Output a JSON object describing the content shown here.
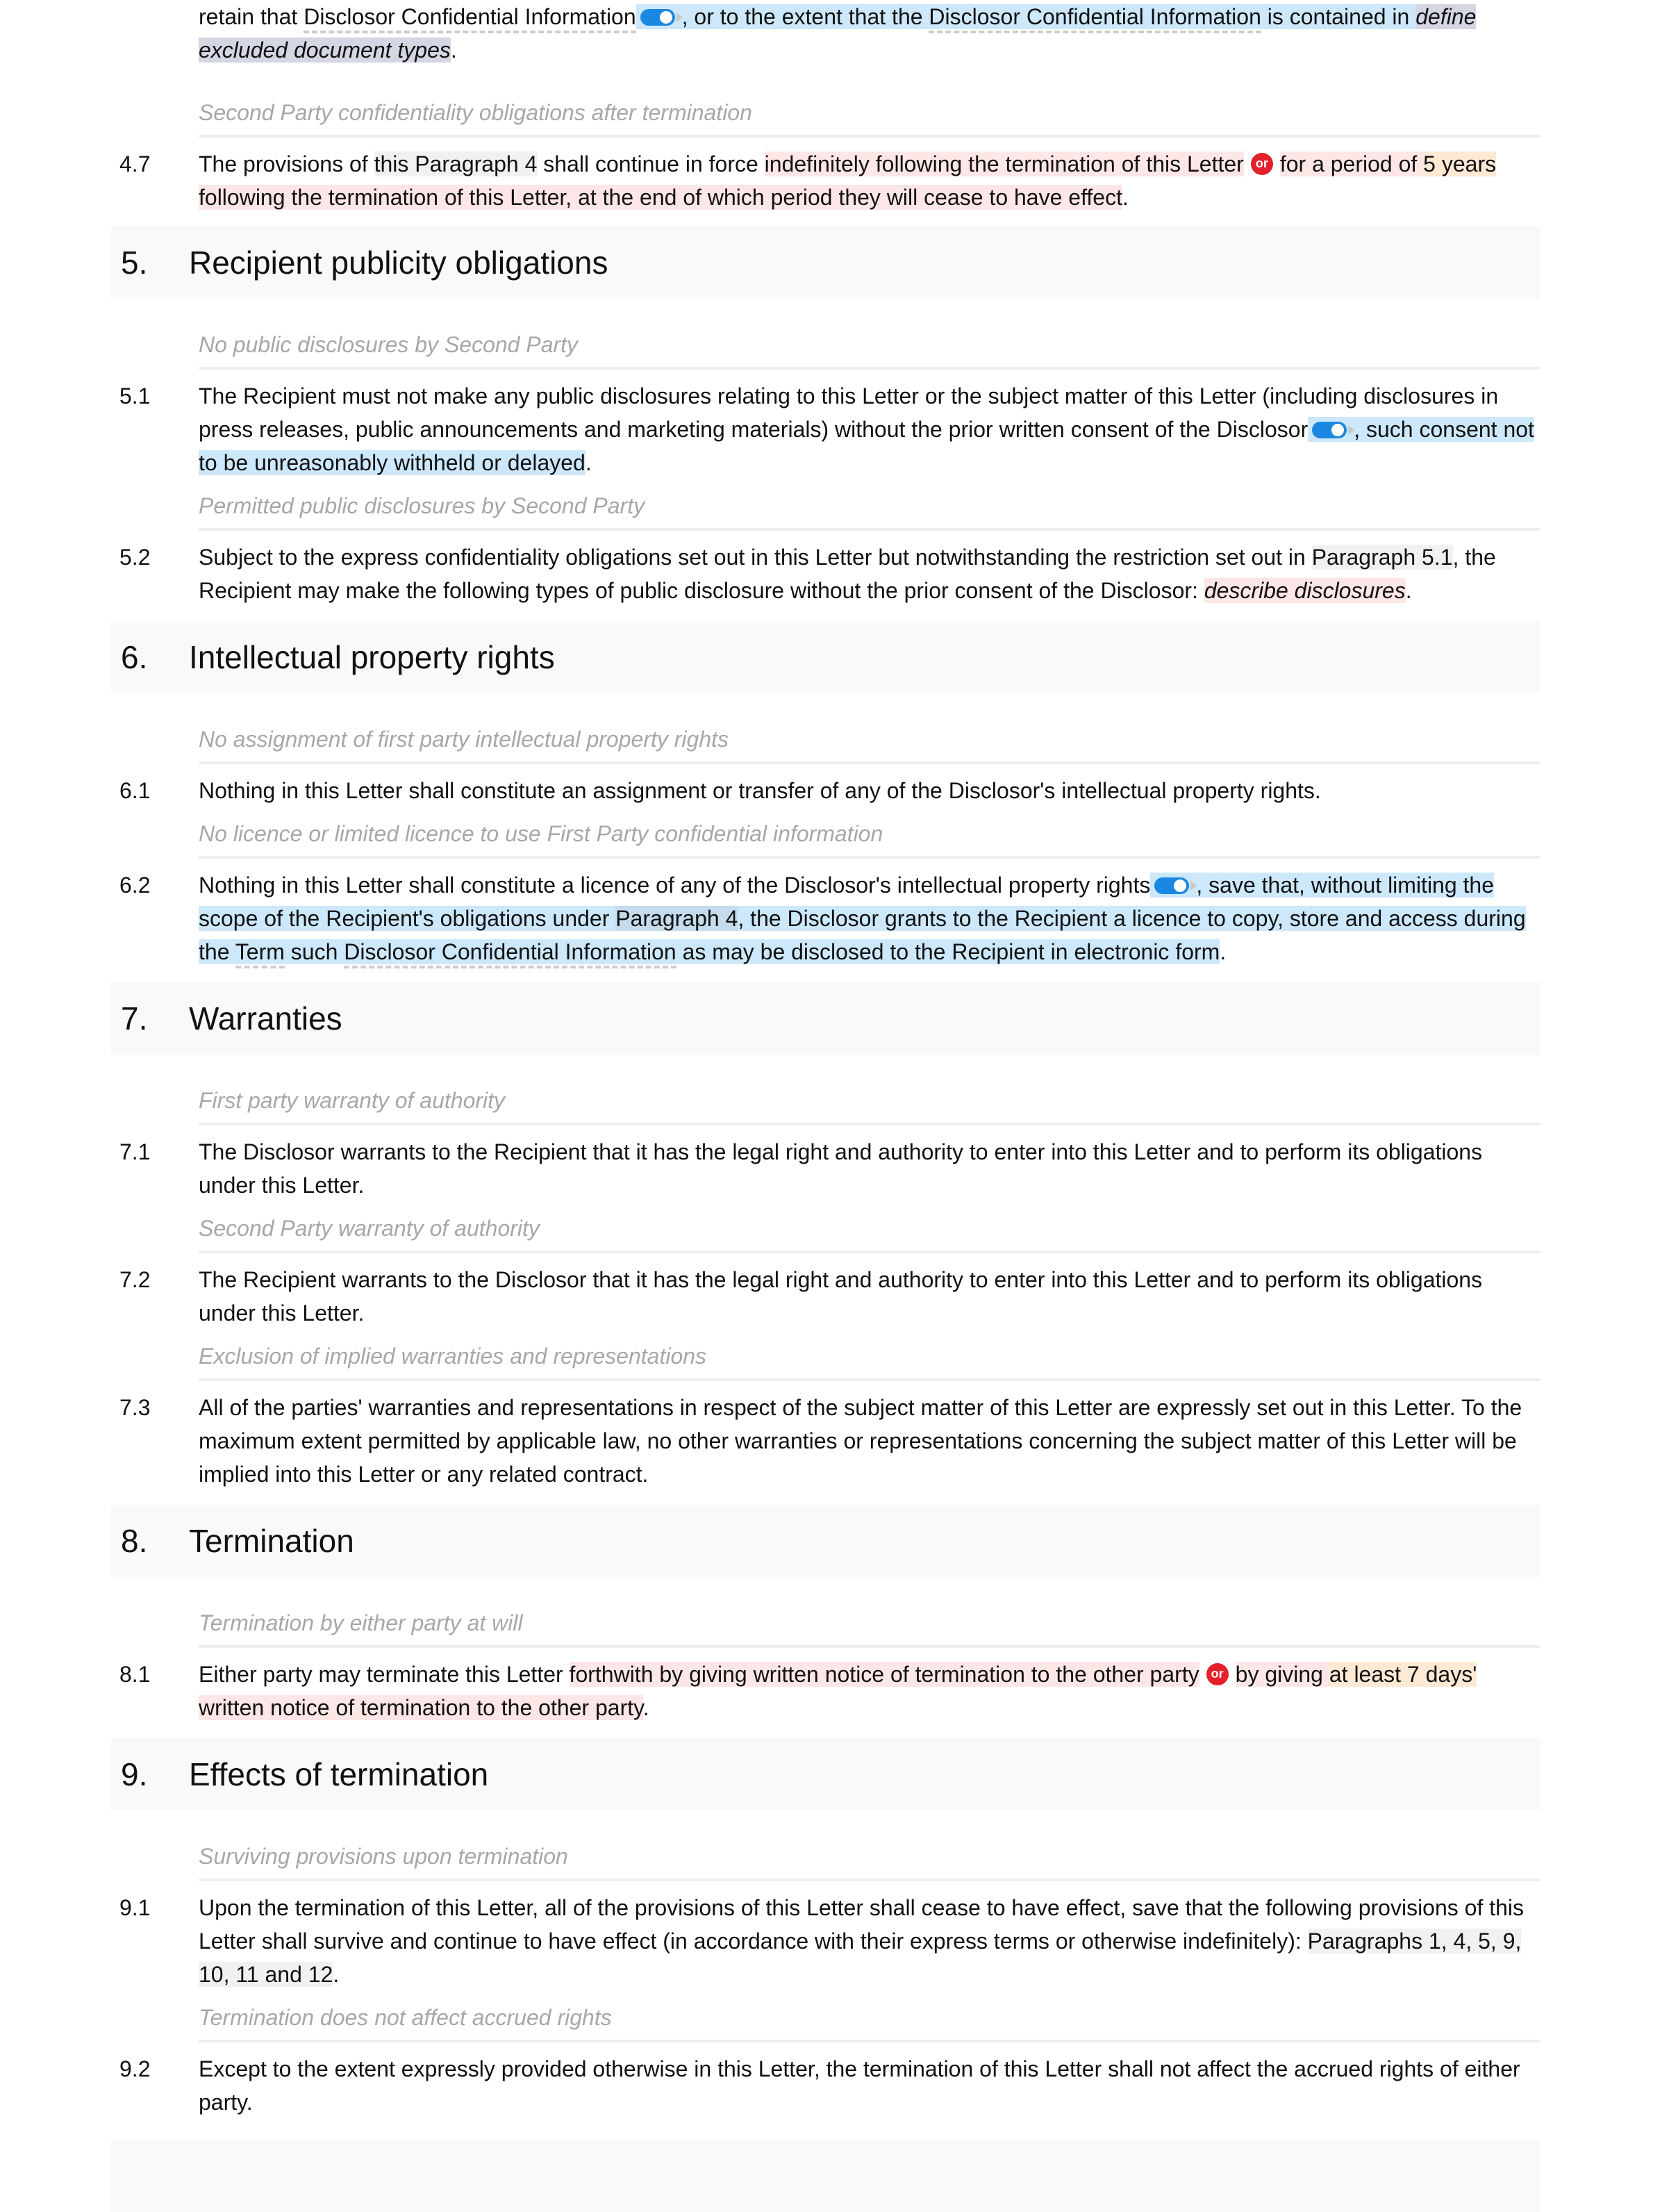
{
  "doc": {
    "p4_6_tail": {
      "a": "retain that ",
      "term": "Disclosor Confidential Information",
      "b": ", or to the extent that the ",
      "term2": "Disclosor Confidential Information",
      "c": " is contained in ",
      "placeholder": "define excluded document types",
      "end": "."
    },
    "n4_7": {
      "note": "Second Party confidentiality obligations after termination",
      "num": "4.7",
      "a": "The provisions of ",
      "ref": "this Paragraph 4",
      "b": " shall continue in force ",
      "opt1": "indefinitely following the termination of this Letter",
      "or": "or",
      "opt2a": "for a period of ",
      "opt2num": "5 years",
      "opt2b": " following the termination of this Letter, at the end of which period they will cease to have effect",
      "end": "."
    },
    "s5": {
      "num": "5.",
      "title": "Recipient publicity obligations",
      "n1": {
        "note": "No public disclosures by Second Party",
        "num": "5.1",
        "a": "The Recipient must not make any public disclosures relating to this Letter or the subject matter of this Letter (including disclosures in press releases, public announcements and marketing materials) without the prior written consent of the Disclosor",
        "opt": ", such consent not to be unreasonably withheld or delayed",
        "end": "."
      },
      "n2": {
        "note": "Permitted public disclosures by Second Party",
        "num": "5.2",
        "a": "Subject to the express confidentiality obligations set out in this Letter but notwithstanding the restriction set out in ",
        "ref": "Paragraph 5.1",
        "b": ", the Recipient may make the following types of public disclosure without the prior consent of the Disclosor: ",
        "placeholder": "describe disclosures",
        "end": "."
      }
    },
    "s6": {
      "num": "6.",
      "title": "Intellectual property rights",
      "n1": {
        "note": "No assignment of first party intellectual property rights",
        "num": "6.1",
        "text": "Nothing in this Letter shall constitute an assignment or transfer of any of the Disclosor's intellectual property rights."
      },
      "n2": {
        "note": "No licence or limited licence to use First Party confidential information",
        "num": "6.2",
        "a": "Nothing in this Letter shall constitute a licence of any of the Disclosor's intellectual property rights",
        "opt_a": ", save that, without limiting the scope of the Recipient's obligations under ",
        "ref": "Paragraph 4",
        "opt_b": ", the Disclosor grants to the Recipient a licence to copy, store and access during the ",
        "term1": "Term",
        "opt_c": " such ",
        "term2": "Disclosor Confidential Information",
        "opt_d": " as may be disclosed to the Recipient in electronic form",
        "end": "."
      }
    },
    "s7": {
      "num": "7.",
      "title": "Warranties",
      "n1": {
        "note": "First party warranty of authority",
        "num": "7.1",
        "text": "The Disclosor warrants to the Recipient that it has the legal right and authority to enter into this Letter and to perform its obligations under this Letter."
      },
      "n2": {
        "note": "Second Party warranty of authority",
        "num": "7.2",
        "text": "The Recipient warrants to the Disclosor that it has the legal right and authority to enter into this Letter and to perform its obligations under this Letter."
      },
      "n3": {
        "note": "Exclusion of implied warranties and representations",
        "num": "7.3",
        "text": "All of the parties' warranties and representations in respect of the subject matter of this Letter are expressly set out in this Letter. To the maximum extent permitted by applicable law, no other warranties or representations concerning the subject matter of this Letter will be implied into this Letter or any related contract."
      }
    },
    "s8": {
      "num": "8.",
      "title": "Termination",
      "n1": {
        "note": "Termination by either party at will",
        "num": "8.1",
        "a": "Either party may terminate this Letter ",
        "opt1": "forthwith by giving written notice of termination to the other party",
        "or": "or",
        "opt2a": "by giving ",
        "opt2num": "at least 7 days'",
        "opt2b": " written notice of termination to the other party",
        "end": "."
      }
    },
    "s9": {
      "num": "9.",
      "title": "Effects of termination",
      "n1": {
        "note": "Surviving provisions upon termination",
        "num": "9.1",
        "a": "Upon the termination of this Letter, all of the provisions of this Letter shall cease to have effect, save that the following provisions of this Letter shall survive and continue to have effect (in accordance with their express terms or otherwise indefinitely): ",
        "ref": "Paragraphs 1, 4, 5, 9, 10, 11 and 12",
        "end": "."
      },
      "n2": {
        "note": "Termination does not affect accrued rights",
        "num": "9.2",
        "text": "Except to the extent expressly provided otherwise in this Letter, the termination of this Letter shall not affect the accrued rights of either party."
      }
    },
    "colors": {
      "optional_clause": "#cde8fb",
      "alternative_clause": "#fde6e6",
      "variable": "#fde9d4",
      "cross_reference": "#f1f1f1",
      "placeholder": "#d5d6e4",
      "toggle": "#1a88e0",
      "or_badge": "#e4202a"
    }
  }
}
